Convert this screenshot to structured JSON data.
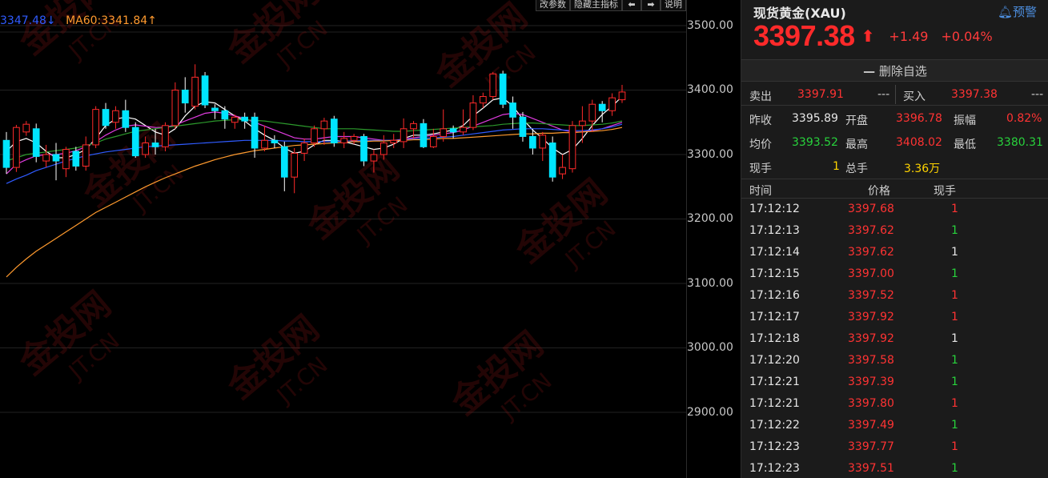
{
  "toolbar": {
    "params_label": "改参数",
    "hide_indicator_label": "隐藏主指标",
    "prev_label": "⬅",
    "next_label": "➡",
    "help_label": "说明"
  },
  "ma_legend": {
    "ma_left": "3347.48↓",
    "ma60": "MA60:3341.84↑",
    "ma_left_color": "#2f5bff",
    "ma60_color": "#ff9a2e"
  },
  "price_axis": {
    "ticks": [
      "3500.00",
      "3400.00",
      "3300.00",
      "3200.00",
      "3100.00",
      "3000.00",
      "2900.00"
    ],
    "range_top": 3500,
    "range_bottom": 2900
  },
  "candles": [
    {
      "o": 3322,
      "c": 3280,
      "h": 3335,
      "l": 3270
    },
    {
      "o": 3280,
      "c": 3342,
      "h": 3346,
      "l": 3273
    },
    {
      "o": 3335,
      "c": 3347,
      "h": 3352,
      "l": 3329
    },
    {
      "o": 3340,
      "c": 3297,
      "h": 3348,
      "l": 3288
    },
    {
      "o": 3290,
      "c": 3300,
      "h": 3315,
      "l": 3280
    },
    {
      "o": 3300,
      "c": 3290,
      "h": 3318,
      "l": 3260
    },
    {
      "o": 3278,
      "c": 3308,
      "h": 3312,
      "l": 3265
    },
    {
      "o": 3305,
      "c": 3282,
      "h": 3312,
      "l": 3275
    },
    {
      "o": 3282,
      "c": 3315,
      "h": 3328,
      "l": 3275
    },
    {
      "o": 3315,
      "c": 3370,
      "h": 3375,
      "l": 3310
    },
    {
      "o": 3370,
      "c": 3345,
      "h": 3380,
      "l": 3340
    },
    {
      "o": 3350,
      "c": 3368,
      "h": 3375,
      "l": 3340
    },
    {
      "o": 3368,
      "c": 3342,
      "h": 3385,
      "l": 3335
    },
    {
      "o": 3342,
      "c": 3298,
      "h": 3350,
      "l": 3295
    },
    {
      "o": 3300,
      "c": 3318,
      "h": 3328,
      "l": 3295
    },
    {
      "o": 3318,
      "c": 3312,
      "h": 3340,
      "l": 3300
    },
    {
      "o": 3312,
      "c": 3345,
      "h": 3350,
      "l": 3305
    },
    {
      "o": 3345,
      "c": 3400,
      "h": 3412,
      "l": 3340
    },
    {
      "o": 3400,
      "c": 3380,
      "h": 3420,
      "l": 3365
    },
    {
      "o": 3375,
      "c": 3420,
      "h": 3440,
      "l": 3370
    },
    {
      "o": 3422,
      "c": 3377,
      "h": 3428,
      "l": 3372
    },
    {
      "o": 3372,
      "c": 3368,
      "h": 3378,
      "l": 3355
    },
    {
      "o": 3368,
      "c": 3355,
      "h": 3375,
      "l": 3340
    },
    {
      "o": 3350,
      "c": 3358,
      "h": 3362,
      "l": 3340
    },
    {
      "o": 3358,
      "c": 3352,
      "h": 3365,
      "l": 3340
    },
    {
      "o": 3358,
      "c": 3310,
      "h": 3365,
      "l": 3295
    },
    {
      "o": 3310,
      "c": 3322,
      "h": 3345,
      "l": 3305
    },
    {
      "o": 3322,
      "c": 3318,
      "h": 3330,
      "l": 3310
    },
    {
      "o": 3312,
      "c": 3265,
      "h": 3320,
      "l": 3243
    },
    {
      "o": 3265,
      "c": 3302,
      "h": 3310,
      "l": 3240
    },
    {
      "o": 3302,
      "c": 3318,
      "h": 3325,
      "l": 3290
    },
    {
      "o": 3318,
      "c": 3340,
      "h": 3345,
      "l": 3312
    },
    {
      "o": 3340,
      "c": 3352,
      "h": 3357,
      "l": 3315
    },
    {
      "o": 3355,
      "c": 3318,
      "h": 3360,
      "l": 3312
    },
    {
      "o": 3318,
      "c": 3325,
      "h": 3335,
      "l": 3310
    },
    {
      "o": 3322,
      "c": 3328,
      "h": 3332,
      "l": 3316
    },
    {
      "o": 3328,
      "c": 3290,
      "h": 3332,
      "l": 3282
    },
    {
      "o": 3290,
      "c": 3300,
      "h": 3308,
      "l": 3272
    },
    {
      "o": 3300,
      "c": 3318,
      "h": 3330,
      "l": 3292
    },
    {
      "o": 3318,
      "c": 3322,
      "h": 3332,
      "l": 3310
    },
    {
      "o": 3320,
      "c": 3340,
      "h": 3356,
      "l": 3310
    },
    {
      "o": 3340,
      "c": 3348,
      "h": 3352,
      "l": 3325
    },
    {
      "o": 3348,
      "c": 3312,
      "h": 3355,
      "l": 3310
    },
    {
      "o": 3312,
      "c": 3328,
      "h": 3340,
      "l": 3310
    },
    {
      "o": 3328,
      "c": 3340,
      "h": 3370,
      "l": 3320
    },
    {
      "o": 3340,
      "c": 3335,
      "h": 3345,
      "l": 3325
    },
    {
      "o": 3335,
      "c": 3342,
      "h": 3370,
      "l": 3330
    },
    {
      "o": 3342,
      "c": 3380,
      "h": 3392,
      "l": 3338
    },
    {
      "o": 3380,
      "c": 3390,
      "h": 3396,
      "l": 3372
    },
    {
      "o": 3390,
      "c": 3425,
      "h": 3428,
      "l": 3385
    },
    {
      "o": 3425,
      "c": 3378,
      "h": 3430,
      "l": 3372
    },
    {
      "o": 3380,
      "c": 3358,
      "h": 3390,
      "l": 3340
    },
    {
      "o": 3358,
      "c": 3328,
      "h": 3366,
      "l": 3320
    },
    {
      "o": 3328,
      "c": 3310,
      "h": 3340,
      "l": 3300
    },
    {
      "o": 3310,
      "c": 3330,
      "h": 3335,
      "l": 3290
    },
    {
      "o": 3318,
      "c": 3265,
      "h": 3328,
      "l": 3258
    },
    {
      "o": 3270,
      "c": 3280,
      "h": 3300,
      "l": 3262
    },
    {
      "o": 3278,
      "c": 3345,
      "h": 3352,
      "l": 3272
    },
    {
      "o": 3345,
      "c": 3352,
      "h": 3375,
      "l": 3318
    },
    {
      "o": 3352,
      "c": 3378,
      "h": 3385,
      "l": 3335
    },
    {
      "o": 3378,
      "c": 3368,
      "h": 3383,
      "l": 3350
    },
    {
      "o": 3368,
      "c": 3388,
      "h": 3395,
      "l": 3360
    },
    {
      "o": 3385,
      "c": 3397,
      "h": 3408,
      "l": 3380
    }
  ],
  "ma_lines": [
    {
      "color": "#ffffff",
      "pts": [
        3305,
        3320,
        3325,
        3318,
        3305,
        3295,
        3295,
        3300,
        3308,
        3325,
        3345,
        3355,
        3358,
        3355,
        3345,
        3335,
        3330,
        3340,
        3360,
        3375,
        3382,
        3380,
        3370,
        3360,
        3352,
        3340,
        3330,
        3322,
        3310,
        3302,
        3305,
        3315,
        3322,
        3322,
        3320,
        3316,
        3312,
        3308,
        3310,
        3316,
        3325,
        3330,
        3330,
        3332,
        3335,
        3338,
        3345,
        3360,
        3372,
        3385,
        3388,
        3375,
        3355,
        3338,
        3325,
        3310,
        3300,
        3308,
        3325,
        3345,
        3362,
        3375,
        3390
      ]
    },
    {
      "color": "#e03ce0",
      "pts": [
        3270,
        3285,
        3292,
        3298,
        3300,
        3300,
        3302,
        3306,
        3312,
        3320,
        3330,
        3338,
        3344,
        3346,
        3344,
        3342,
        3342,
        3346,
        3352,
        3358,
        3364,
        3366,
        3364,
        3360,
        3356,
        3350,
        3344,
        3338,
        3332,
        3326,
        3324,
        3324,
        3326,
        3328,
        3328,
        3328,
        3326,
        3324,
        3322,
        3322,
        3324,
        3326,
        3328,
        3330,
        3332,
        3334,
        3338,
        3344,
        3350,
        3356,
        3362,
        3364,
        3362,
        3356,
        3350,
        3344,
        3338,
        3335,
        3335,
        3337,
        3340,
        3345,
        3350
      ]
    },
    {
      "color": "#2c9a2c",
      "pts": [
        3290,
        3295,
        3300,
        3302,
        3304,
        3306,
        3308,
        3310,
        3314,
        3318,
        3324,
        3328,
        3332,
        3336,
        3338,
        3340,
        3342,
        3344,
        3346,
        3348,
        3350,
        3352,
        3353,
        3354,
        3354,
        3353,
        3352,
        3350,
        3348,
        3346,
        3344,
        3342,
        3340,
        3340,
        3340,
        3340,
        3339,
        3338,
        3337,
        3336,
        3336,
        3337,
        3338,
        3339,
        3340,
        3341,
        3342,
        3343,
        3344,
        3345,
        3347,
        3348,
        3349,
        3349,
        3348,
        3347,
        3346,
        3345,
        3345,
        3346,
        3347,
        3349,
        3352
      ]
    },
    {
      "color": "#2f5bff",
      "pts": [
        3255,
        3262,
        3268,
        3275,
        3280,
        3285,
        3290,
        3294,
        3298,
        3301,
        3304,
        3306,
        3308,
        3310,
        3312,
        3313,
        3314,
        3315,
        3316,
        3317,
        3318,
        3319,
        3320,
        3321,
        3322,
        3322,
        3322,
        3322,
        3321,
        3321,
        3320,
        3320,
        3320,
        3320,
        3321,
        3321,
        3322,
        3322,
        3322,
        3322,
        3323,
        3324,
        3325,
        3326,
        3327,
        3328,
        3330,
        3332,
        3334,
        3336,
        3338,
        3339,
        3340,
        3340,
        3340,
        3339,
        3338,
        3337,
        3337,
        3338,
        3340,
        3343,
        3347
      ]
    },
    {
      "color": "#ff9a2e",
      "pts": [
        3110,
        3125,
        3138,
        3150,
        3160,
        3170,
        3180,
        3190,
        3200,
        3210,
        3218,
        3226,
        3234,
        3242,
        3250,
        3257,
        3264,
        3270,
        3276,
        3282,
        3287,
        3292,
        3296,
        3300,
        3303,
        3306,
        3308,
        3310,
        3312,
        3314,
        3315,
        3316,
        3317,
        3318,
        3319,
        3320,
        3320,
        3321,
        3321,
        3322,
        3322,
        3323,
        3323,
        3324,
        3325,
        3325,
        3326,
        3327,
        3328,
        3329,
        3330,
        3331,
        3332,
        3332,
        3333,
        3333,
        3334,
        3334,
        3335,
        3336,
        3337,
        3339,
        3342
      ]
    }
  ],
  "quote": {
    "title": "现货黄金(XAU)",
    "alert_label": "预警",
    "price": "3397.38",
    "change": "+1.49",
    "change_pct": "+0.04%",
    "delete_watch": "删除自选",
    "sell_label": "卖出",
    "sell_price": "3397.91",
    "sell_vol": "---",
    "buy_label": "买入",
    "buy_price": "3397.38",
    "buy_vol": "---",
    "stats": {
      "prev_close_label": "昨收",
      "prev_close": "3395.89",
      "open_label": "开盘",
      "open": "3396.78",
      "amplitude_label": "振幅",
      "amplitude": "0.82%",
      "avg_label": "均价",
      "avg": "3393.52",
      "high_label": "最高",
      "high": "3408.02",
      "low_label": "最低",
      "low": "3380.31",
      "cur_vol_label": "现手",
      "cur_vol": "1",
      "total_vol_label": "总手",
      "total_vol": "3.36万"
    }
  },
  "ticks": {
    "headers": {
      "time": "时间",
      "price": "价格",
      "vol": "现手"
    },
    "rows": [
      {
        "time": "17:12:12",
        "price": "3397.68",
        "vol": "1",
        "vc": "c-red"
      },
      {
        "time": "17:12:13",
        "price": "3397.62",
        "vol": "1",
        "vc": "c-green"
      },
      {
        "time": "17:12:14",
        "price": "3397.62",
        "vol": "1",
        "vc": "c-white"
      },
      {
        "time": "17:12:15",
        "price": "3397.00",
        "vol": "1",
        "vc": "c-green"
      },
      {
        "time": "17:12:16",
        "price": "3397.52",
        "vol": "1",
        "vc": "c-red"
      },
      {
        "time": "17:12:17",
        "price": "3397.92",
        "vol": "1",
        "vc": "c-red"
      },
      {
        "time": "17:12:18",
        "price": "3397.92",
        "vol": "1",
        "vc": "c-white"
      },
      {
        "time": "17:12:20",
        "price": "3397.58",
        "vol": "1",
        "vc": "c-green"
      },
      {
        "time": "17:12:21",
        "price": "3397.39",
        "vol": "1",
        "vc": "c-green"
      },
      {
        "time": "17:12:21",
        "price": "3397.80",
        "vol": "1",
        "vc": "c-red"
      },
      {
        "time": "17:12:22",
        "price": "3397.49",
        "vol": "1",
        "vc": "c-green"
      },
      {
        "time": "17:12:23",
        "price": "3397.77",
        "vol": "1",
        "vc": "c-red"
      },
      {
        "time": "17:12:23",
        "price": "3397.51",
        "vol": "1",
        "vc": "c-green"
      }
    ]
  },
  "colors": {
    "up": "#ff2a2a",
    "down": "#00e5ff",
    "accent_blue": "#4d8fe0",
    "green": "#28d23c",
    "yellow": "#ffd400"
  },
  "icons": {
    "alert": "bell-alert-icon",
    "up_arrow": "up-arrow-icon",
    "minus": "minus-icon",
    "prev": "left-arrow-icon",
    "next": "right-arrow-icon"
  }
}
